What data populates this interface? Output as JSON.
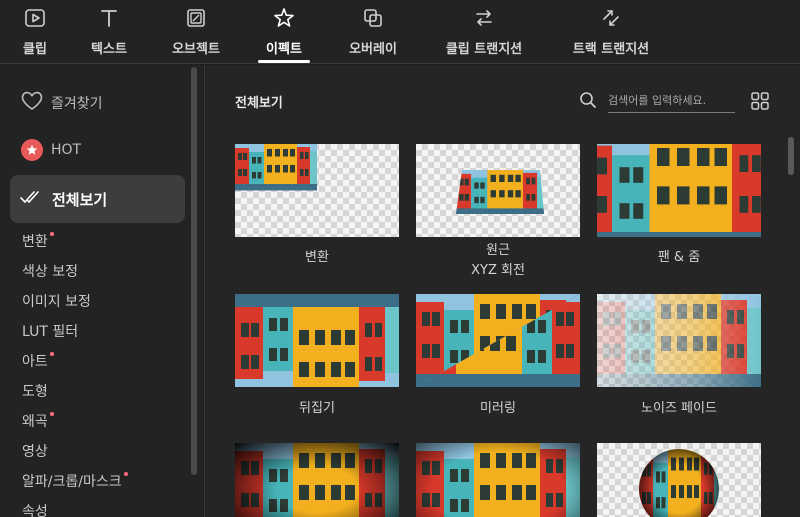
{
  "tabs": [
    {
      "label": "클립",
      "icon": "play-icon"
    },
    {
      "label": "텍스트",
      "icon": "text-icon"
    },
    {
      "label": "오브젝트",
      "icon": "sticker-icon"
    },
    {
      "label": "이펙트",
      "icon": "sparkle-star-icon",
      "active": true
    },
    {
      "label": "오버레이",
      "icon": "overlay-icon"
    },
    {
      "label": "클립 트랜지션",
      "icon": "swap-arrows-icon"
    },
    {
      "label": "트랙 트랜지션",
      "icon": "diagonal-arrows-icon"
    }
  ],
  "sidebar": {
    "favorites": "즐겨찾기",
    "hot": "HOT",
    "all": "전체보기",
    "categories": [
      {
        "label": "변환",
        "new": true
      },
      {
        "label": "색상 보정",
        "new": false
      },
      {
        "label": "이미지 보정",
        "new": false
      },
      {
        "label": "LUT 필터",
        "new": false
      },
      {
        "label": "아트",
        "new": true
      },
      {
        "label": "도형",
        "new": false
      },
      {
        "label": "왜곡",
        "new": true
      },
      {
        "label": "영상",
        "new": false
      },
      {
        "label": "알파/크롭/마스크",
        "new": true
      },
      {
        "label": "속성",
        "new": false
      }
    ]
  },
  "main": {
    "title": "전체보기",
    "search_placeholder": "검색어를 입력하세요.",
    "effects": [
      {
        "name": "변환"
      },
      {
        "name": "원근",
        "sub": "XYZ 회전"
      },
      {
        "name": "팬 & 줌"
      },
      {
        "name": "뒤집기"
      },
      {
        "name": "미러링"
      },
      {
        "name": "노이즈 페이드"
      }
    ]
  },
  "colors": {
    "accent": "#ffffff",
    "new_dot": "#ff6b7a",
    "hot_badge": "#e85a5a",
    "selected_bg": "#3d3d3d"
  }
}
